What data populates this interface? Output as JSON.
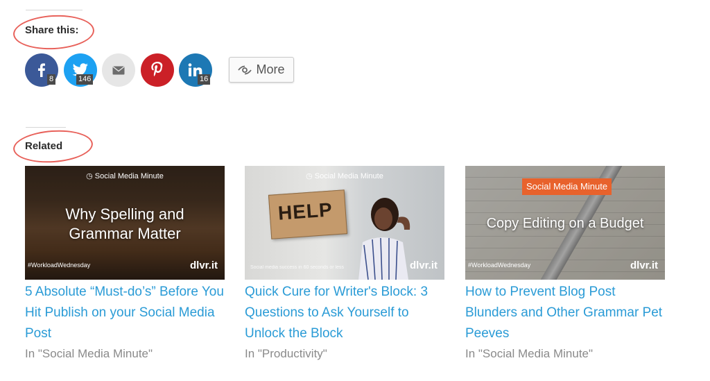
{
  "share": {
    "title": "Share this:",
    "buttons": [
      {
        "network": "facebook",
        "icon": "facebook-icon",
        "count": "8",
        "color": "#3b5998"
      },
      {
        "network": "twitter",
        "icon": "twitter-icon",
        "count": "146",
        "color": "#1da1f2"
      },
      {
        "network": "email",
        "icon": "email-icon",
        "count": "",
        "color": "#e6e6e6"
      },
      {
        "network": "pinterest",
        "icon": "pinterest-icon",
        "count": "",
        "color": "#cb2027"
      },
      {
        "network": "linkedin",
        "icon": "linkedin-icon",
        "count": "16",
        "color": "#1d78b4"
      }
    ],
    "more_label": "More",
    "more_icon": "share-icon"
  },
  "related": {
    "title": "Related",
    "posts": [
      {
        "thumb_brand": "Social Media Minute",
        "thumb_headline_line1": "Why Spelling and",
        "thumb_headline_line2": "Grammar Matter",
        "thumb_hashtag": "#WorkloadWednesday",
        "thumb_logo": "dlvr.it",
        "title": "5 Absolute “Must-do’s” Before You Hit Publish on your Social Media Post",
        "category": "In \"Social Media Minute\""
      },
      {
        "thumb_brand": "Social Media Minute",
        "thumb_sign": "HELP",
        "thumb_fine": "Social media success in 60 seconds or less",
        "thumb_logo": "dlvr.it",
        "title": "Quick Cure for Writer's Block: 3 Questions to Ask Yourself to Unlock the Block",
        "category": "In \"Productivity\""
      },
      {
        "thumb_brand": "Social Media Minute",
        "thumb_headline_line1": "Copy Editing on a Budget",
        "thumb_hashtag": "#WorkloadWednesday",
        "thumb_logo": "dlvr.it",
        "title": "How to Prevent Blog Post Blunders and Other Grammar Pet Peeves",
        "category": "In \"Social Media Minute\""
      }
    ]
  },
  "colors": {
    "link": "#2a9bd6",
    "annotation": "#e8615a",
    "brand_orange": "#e8622c"
  }
}
